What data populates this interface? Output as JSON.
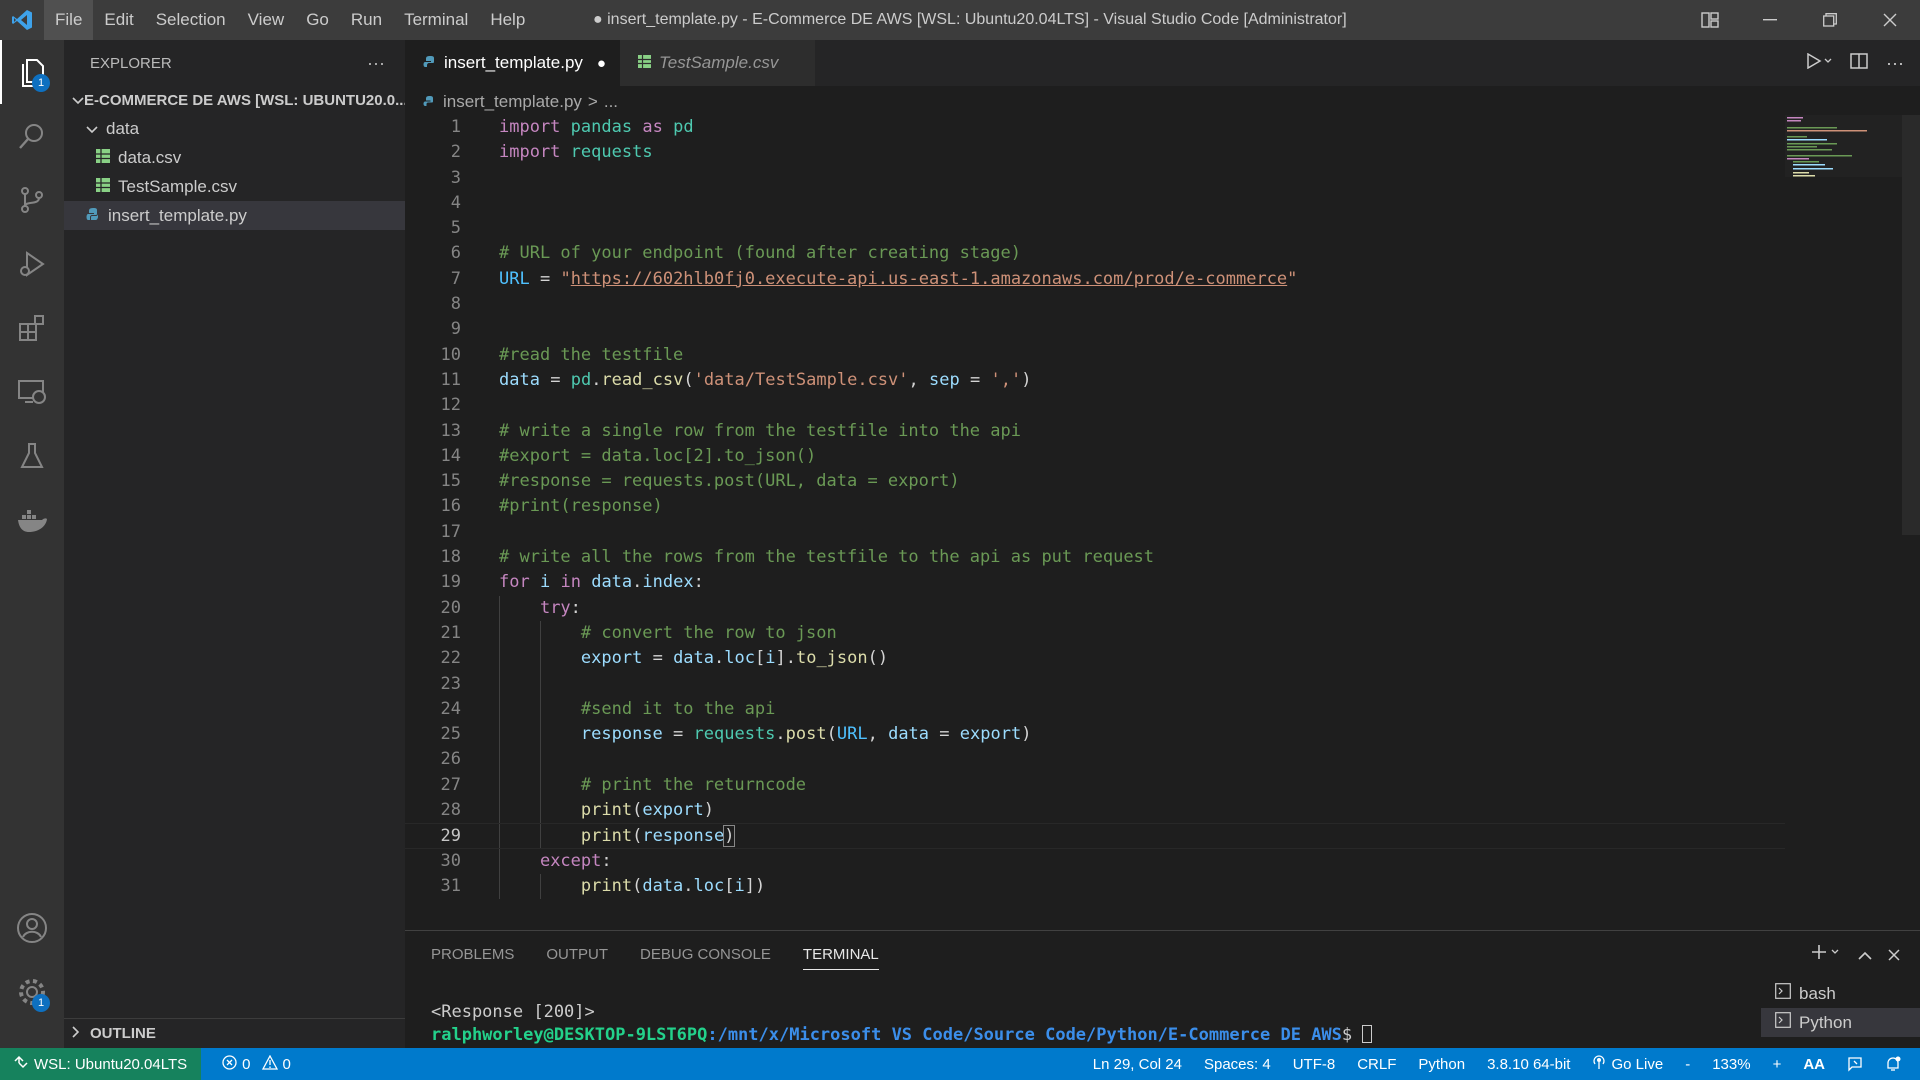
{
  "window": {
    "title": "● insert_template.py - E-Commerce DE AWS [WSL: Ubuntu20.04LTS] - Visual Studio Code [Administrator]"
  },
  "menu": [
    "File",
    "Edit",
    "Selection",
    "View",
    "Go",
    "Run",
    "Terminal",
    "Help"
  ],
  "activity_bar": {
    "explorer_badge": "1",
    "settings_badge": "1",
    "icons": [
      "explorer-icon",
      "search-icon",
      "source-control-icon",
      "run-debug-icon",
      "extensions-icon",
      "remote-explorer-icon",
      "testing-icon",
      "docker-icon",
      "accounts-icon",
      "settings-gear-icon"
    ]
  },
  "sidebar": {
    "header": "EXPLORER",
    "more": "···",
    "workspace": "E-COMMERCE DE AWS [WSL: UBUNTU20.0...",
    "folder": "data",
    "files_in_folder": [
      "data.csv",
      "TestSample.csv"
    ],
    "root_file": "insert_template.py",
    "outline": "OUTLINE"
  },
  "tabs": [
    {
      "label": "insert_template.py",
      "modified": "●"
    },
    {
      "label": "TestSample.csv"
    }
  ],
  "breadcrumb": {
    "file": "insert_template.py",
    "sep": ">",
    "rest": "..."
  },
  "status": {
    "remote": "WSL: Ubuntu20.04LTS",
    "errors": "0",
    "warnings": "0",
    "position": "Ln 29, Col 24",
    "spaces": "Spaces: 4",
    "encoding": "UTF-8",
    "eol": "CRLF",
    "language": "Python",
    "interpreter": "3.8.10 64-bit",
    "golive": "Go Live",
    "zoom_minus": "-",
    "zoom": "133%",
    "zoom_plus": "+",
    "font_size": "AA"
  },
  "panel": {
    "tabs": [
      "PROBLEMS",
      "OUTPUT",
      "DEBUG CONSOLE",
      "TERMINAL"
    ],
    "terminal_output": "<Response [200]>",
    "prompt_user": "ralphworley@DESKTOP-9LST6PQ",
    "prompt_path": ":/mnt/x/Microsoft VS Code/Source Code/Python/E-Commerce DE AWS",
    "prompt_sign": "$ ",
    "terminals": [
      "bash",
      "Python"
    ]
  },
  "colors": {
    "accent": "#007acc",
    "remote": "#16825d",
    "csv_icon": "#89d185",
    "py_icon": "#519aba"
  }
}
